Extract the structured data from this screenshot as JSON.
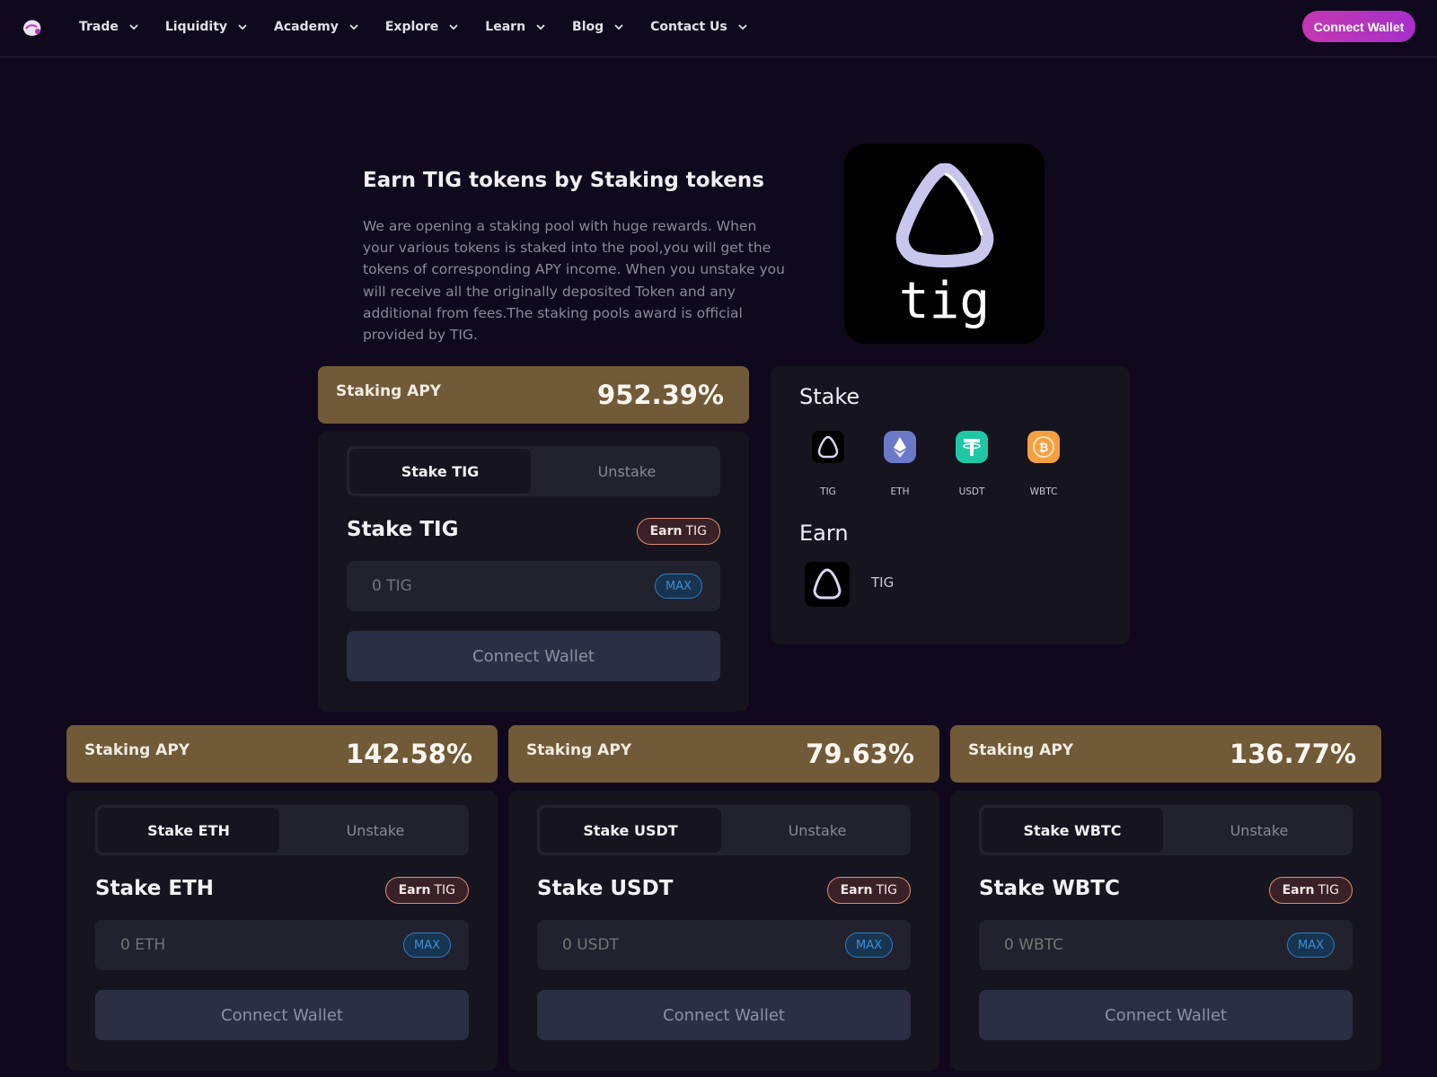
{
  "nav": {
    "items": [
      {
        "label": "Trade"
      },
      {
        "label": "Liquidity"
      },
      {
        "label": "Academy"
      },
      {
        "label": "Explore"
      },
      {
        "label": "Learn"
      },
      {
        "label": "Blog"
      },
      {
        "label": "Contact Us"
      }
    ],
    "connect_label": "Connect Wallet"
  },
  "hero": {
    "title": "Earn TIG tokens by Staking tokens",
    "description": "We are opening a staking pool with huge rewards. When your various tokens is staked into the pool,you will get the tokens of corresponding APY income. When you unstake you will receive all the originally deposited Token and any additional from fees.The staking pools award is official provided by TIG.",
    "logo_text": "tig"
  },
  "pools": [
    {
      "apy_label": "Staking APY",
      "apy": "952.39%",
      "tab_stake": "Stake TIG",
      "tab_unstake": "Unstake",
      "title": "Stake TIG",
      "earn_bold": "Earn",
      "earn_token": "TIG",
      "placeholder": "0 TIG",
      "max": "MAX",
      "connect": "Connect Wallet"
    },
    {
      "apy_label": "Staking APY",
      "apy": "142.58%",
      "tab_stake": "Stake ETH",
      "tab_unstake": "Unstake",
      "title": "Stake ETH",
      "earn_bold": "Earn",
      "earn_token": "TIG",
      "placeholder": "0 ETH",
      "max": "MAX",
      "connect": "Connect Wallet"
    },
    {
      "apy_label": "Staking APY",
      "apy": "79.63%",
      "tab_stake": "Stake USDT",
      "tab_unstake": "Unstake",
      "title": "Stake USDT",
      "earn_bold": "Earn",
      "earn_token": "TIG",
      "placeholder": "0 USDT",
      "max": "MAX",
      "connect": "Connect Wallet"
    },
    {
      "apy_label": "Staking APY",
      "apy": "136.77%",
      "tab_stake": "Stake WBTC",
      "tab_unstake": "Unstake",
      "title": "Stake WBTC",
      "earn_bold": "Earn",
      "earn_token": "TIG",
      "placeholder": "0 WBTC",
      "max": "MAX",
      "connect": "Connect Wallet"
    }
  ],
  "info": {
    "stake_heading": "Stake",
    "tokens": [
      {
        "label": "TIG",
        "icon": "tig-icon",
        "color": "#000000"
      },
      {
        "label": "ETH",
        "icon": "eth-icon",
        "color": "#6b79c8"
      },
      {
        "label": "USDT",
        "icon": "usdt-icon",
        "color": "#1fc7a6"
      },
      {
        "label": "WBTC",
        "icon": "wbtc-icon",
        "color": "#f4a041"
      }
    ],
    "earn_heading": "Earn",
    "earn_token": "TIG"
  },
  "colors": {
    "background": "#10081c",
    "card": "#15141f",
    "apy_bar": "#715a38",
    "accent_gradient_start": "#c438b2",
    "accent_gradient_end": "#a630c8"
  }
}
